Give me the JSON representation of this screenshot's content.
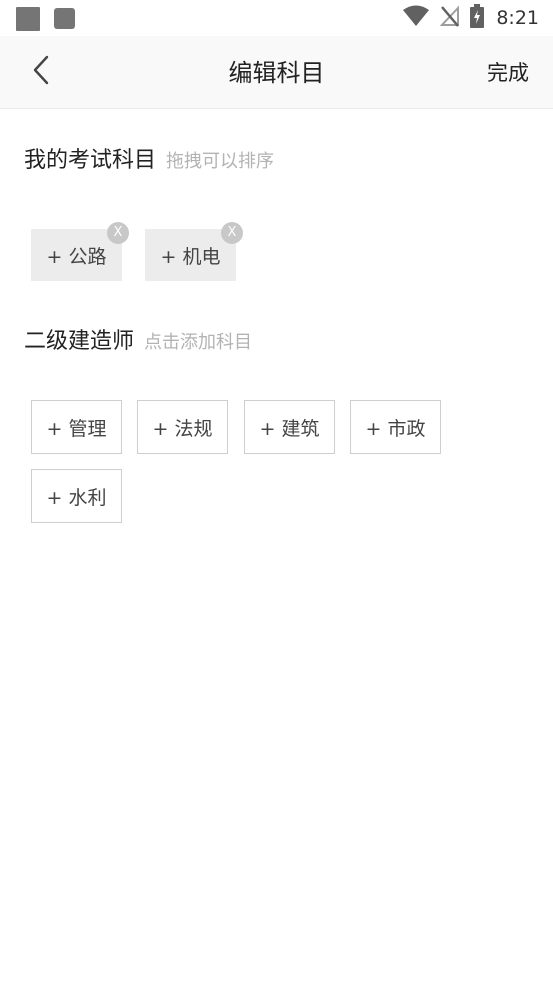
{
  "status_bar": {
    "time": "8:21",
    "icons": [
      "notification-square-icon",
      "notification-square-icon",
      "wifi-icon",
      "no-signal-icon",
      "battery-charging-icon"
    ]
  },
  "header": {
    "back_icon": "chevron-left-icon",
    "title": "编辑科目",
    "done_label": "完成"
  },
  "my_subjects": {
    "title": "我的考试科目",
    "hint": "拖拽可以排序",
    "remove_symbol": "X",
    "items": [
      {
        "label": "+ 公路"
      },
      {
        "label": "+ 机电"
      }
    ]
  },
  "available": {
    "title": "二级建造师",
    "hint": "点击添加科目",
    "items": [
      {
        "label": "+ 管理"
      },
      {
        "label": "+ 法规"
      },
      {
        "label": "+ 建筑"
      },
      {
        "label": "+ 市政"
      },
      {
        "label": "+ 水利"
      }
    ]
  },
  "colors": {
    "title_bar_bg": "#f9f9f9",
    "tag_mine_bg": "#ececec",
    "tag_border": "#cfcfcf",
    "hint_text": "#b3b3b3",
    "badge_bg": "#c8c8c8"
  }
}
